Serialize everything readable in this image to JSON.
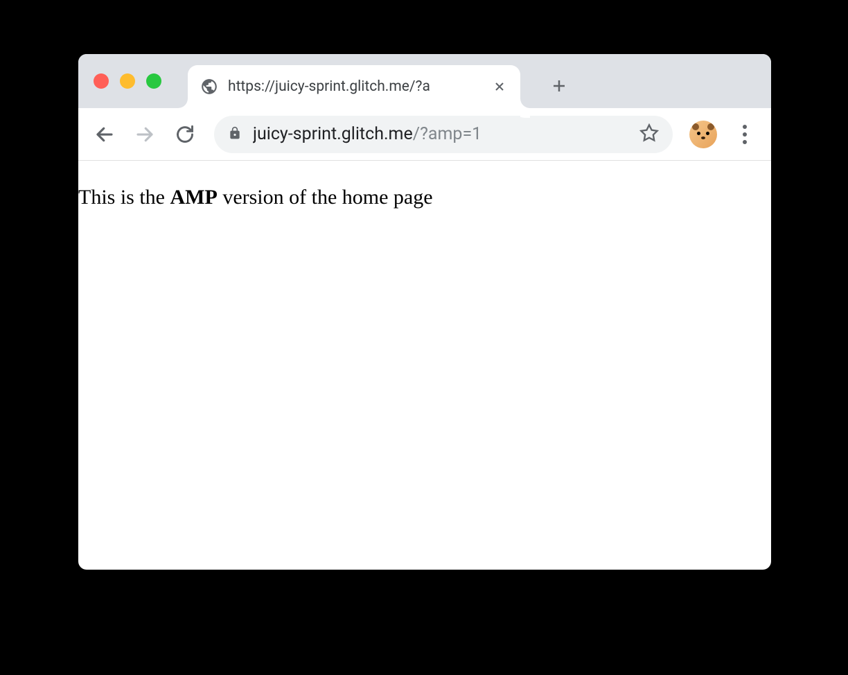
{
  "tab": {
    "title": "https://juicy-sprint.glitch.me/?a"
  },
  "address": {
    "domain": "juicy-sprint.glitch.me",
    "path": "/?amp=1"
  },
  "page": {
    "text_before": "This is the ",
    "text_bold": "AMP",
    "text_after": " version of the home page"
  }
}
